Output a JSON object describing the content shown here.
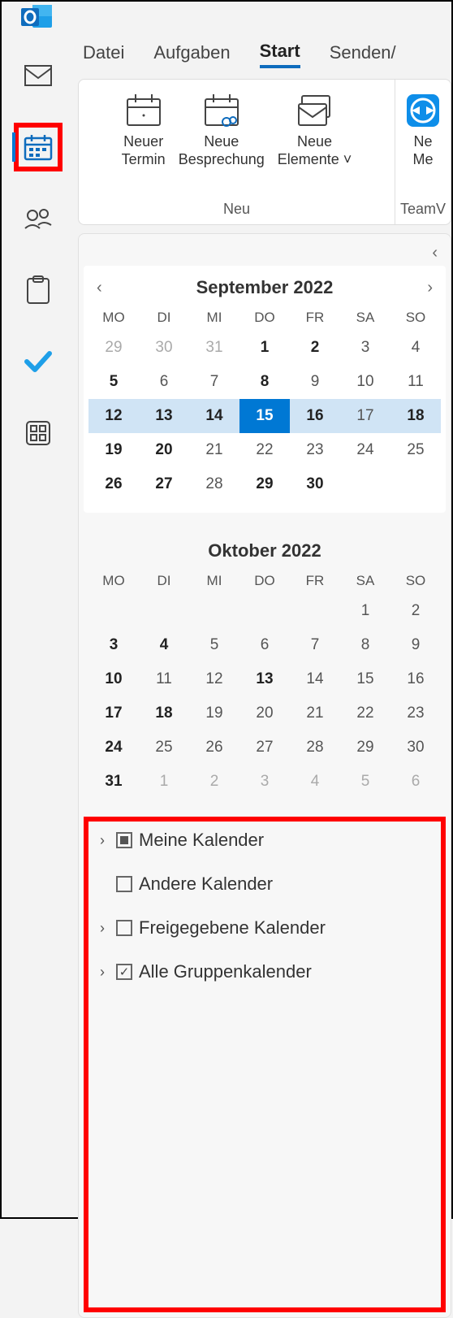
{
  "tabs": {
    "t0": "Datei",
    "t1": "Aufgaben",
    "t2": "Start",
    "t3": "Senden/"
  },
  "ribbon": {
    "groupLabel": "Neu",
    "i0a": "Neuer",
    "i0b": "Termin",
    "i1a": "Neue",
    "i1b": "Besprechung",
    "i2a": "Neue",
    "i2b": "Elemente ˅",
    "group2Label": "TeamV",
    "i3a": "Ne",
    "i3b": "Me"
  },
  "cal1": {
    "title": "September 2022",
    "dow": [
      "MO",
      "DI",
      "MI",
      "DO",
      "FR",
      "SA",
      "SO"
    ],
    "days": [
      {
        "n": "29",
        "c": "other"
      },
      {
        "n": "30",
        "c": "other"
      },
      {
        "n": "31",
        "c": "other"
      },
      {
        "n": "1",
        "c": "bold"
      },
      {
        "n": "2",
        "c": "bold"
      },
      {
        "n": "3",
        "c": ""
      },
      {
        "n": "4",
        "c": ""
      },
      {
        "n": "5",
        "c": "bold"
      },
      {
        "n": "6",
        "c": ""
      },
      {
        "n": "7",
        "c": ""
      },
      {
        "n": "8",
        "c": "bold"
      },
      {
        "n": "9",
        "c": ""
      },
      {
        "n": "10",
        "c": ""
      },
      {
        "n": "11",
        "c": ""
      },
      {
        "n": "12",
        "c": "bold sel-week"
      },
      {
        "n": "13",
        "c": "bold sel-week"
      },
      {
        "n": "14",
        "c": "bold sel-week"
      },
      {
        "n": "15",
        "c": "today"
      },
      {
        "n": "16",
        "c": "bold sel-week"
      },
      {
        "n": "17",
        "c": "sel-week"
      },
      {
        "n": "18",
        "c": "bold sel-week"
      },
      {
        "n": "19",
        "c": "bold"
      },
      {
        "n": "20",
        "c": "bold"
      },
      {
        "n": "21",
        "c": ""
      },
      {
        "n": "22",
        "c": ""
      },
      {
        "n": "23",
        "c": ""
      },
      {
        "n": "24",
        "c": ""
      },
      {
        "n": "25",
        "c": ""
      },
      {
        "n": "26",
        "c": "bold"
      },
      {
        "n": "27",
        "c": "bold"
      },
      {
        "n": "28",
        "c": ""
      },
      {
        "n": "29",
        "c": "bold"
      },
      {
        "n": "30",
        "c": "bold"
      }
    ]
  },
  "cal2": {
    "title": "Oktober 2022",
    "dow": [
      "MO",
      "DI",
      "MI",
      "DO",
      "FR",
      "SA",
      "SO"
    ],
    "days": [
      {
        "n": "",
        "c": ""
      },
      {
        "n": "",
        "c": ""
      },
      {
        "n": "",
        "c": ""
      },
      {
        "n": "",
        "c": ""
      },
      {
        "n": "",
        "c": ""
      },
      {
        "n": "1",
        "c": ""
      },
      {
        "n": "2",
        "c": ""
      },
      {
        "n": "3",
        "c": "bold"
      },
      {
        "n": "4",
        "c": "bold"
      },
      {
        "n": "5",
        "c": ""
      },
      {
        "n": "6",
        "c": ""
      },
      {
        "n": "7",
        "c": ""
      },
      {
        "n": "8",
        "c": ""
      },
      {
        "n": "9",
        "c": ""
      },
      {
        "n": "10",
        "c": "bold"
      },
      {
        "n": "11",
        "c": ""
      },
      {
        "n": "12",
        "c": ""
      },
      {
        "n": "13",
        "c": "bold"
      },
      {
        "n": "14",
        "c": ""
      },
      {
        "n": "15",
        "c": ""
      },
      {
        "n": "16",
        "c": ""
      },
      {
        "n": "17",
        "c": "bold"
      },
      {
        "n": "18",
        "c": "bold"
      },
      {
        "n": "19",
        "c": ""
      },
      {
        "n": "20",
        "c": ""
      },
      {
        "n": "21",
        "c": ""
      },
      {
        "n": "22",
        "c": ""
      },
      {
        "n": "23",
        "c": ""
      },
      {
        "n": "24",
        "c": "bold"
      },
      {
        "n": "25",
        "c": ""
      },
      {
        "n": "26",
        "c": ""
      },
      {
        "n": "27",
        "c": ""
      },
      {
        "n": "28",
        "c": ""
      },
      {
        "n": "29",
        "c": ""
      },
      {
        "n": "30",
        "c": ""
      },
      {
        "n": "31",
        "c": "bold"
      },
      {
        "n": "1",
        "c": "other"
      },
      {
        "n": "2",
        "c": "other"
      },
      {
        "n": "3",
        "c": "other"
      },
      {
        "n": "4",
        "c": "other"
      },
      {
        "n": "5",
        "c": "other"
      },
      {
        "n": "6",
        "c": "other"
      }
    ]
  },
  "calList": {
    "l0": "Meine Kalender",
    "l1": "Andere Kalender",
    "l2": "Freigegebene Kalender",
    "l3": "Alle Gruppenkalender"
  }
}
